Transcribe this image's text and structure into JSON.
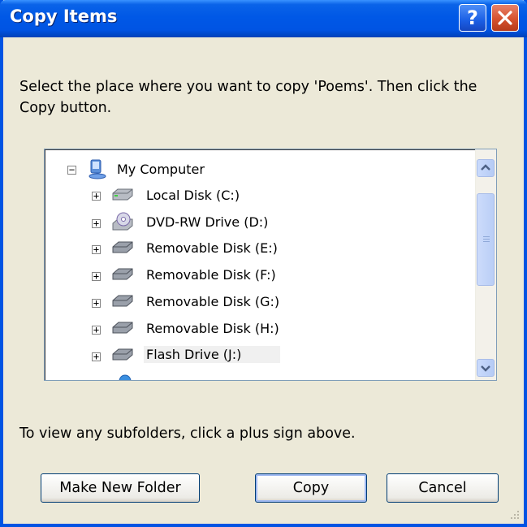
{
  "window": {
    "title": "Copy Items",
    "help_label": "?"
  },
  "instruction": "Select the place where you want to copy 'Poems'. Then click the Copy button.",
  "tree": {
    "root": {
      "label": "My Computer",
      "expander": "−"
    },
    "items": [
      {
        "label": "Local Disk (C:)",
        "icon": "hard-disk-icon",
        "expander": "+"
      },
      {
        "label": "DVD-RW Drive (D:)",
        "icon": "dvd-drive-icon",
        "expander": "+"
      },
      {
        "label": "Removable Disk (E:)",
        "icon": "removable-disk-icon",
        "expander": "+"
      },
      {
        "label": "Removable Disk (F:)",
        "icon": "removable-disk-icon",
        "expander": "+"
      },
      {
        "label": "Removable Disk (G:)",
        "icon": "removable-disk-icon",
        "expander": "+"
      },
      {
        "label": "Removable Disk (H:)",
        "icon": "removable-disk-icon",
        "expander": "+"
      },
      {
        "label": "Flash Drive (J:)",
        "icon": "removable-disk-icon",
        "expander": "+",
        "selected": true
      }
    ]
  },
  "hint": "To view any subfolders, click a plus sign above.",
  "buttons": {
    "make_new_folder": "Make New Folder",
    "copy": "Copy",
    "cancel": "Cancel"
  },
  "colors": {
    "titlebar": "#0054E3",
    "dialog_bg": "#ECE9D8",
    "close_button": "#D6512E",
    "button_border": "#003C74"
  }
}
